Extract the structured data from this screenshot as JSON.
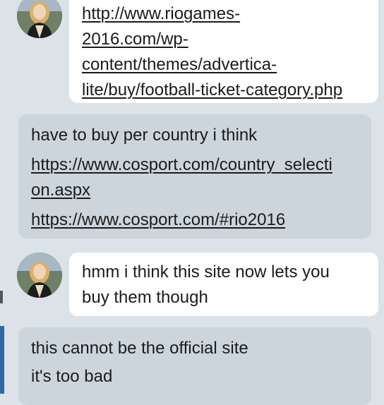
{
  "conversation": {
    "messages": [
      {
        "sender": "other",
        "link_lines": [
          "http://www.riogames-",
          "2016.com/wp-",
          "content/themes/advertica-",
          "lite/buy/football-ticket-category.php"
        ]
      },
      {
        "sender": "me",
        "text": "have to buy per country i think",
        "link1_lines": [
          "https://www.cosport.com/country_selecti",
          "on.aspx"
        ],
        "link2": "https://www.cosport.com/#rio2016"
      },
      {
        "sender": "other",
        "text_lines": [
          "hmm i think this site now lets you",
          "buy them though"
        ]
      },
      {
        "sender": "me",
        "text1": "this cannot be the official site",
        "text2": "it's too bad"
      }
    ]
  },
  "colors": {
    "background": "#dbe2e8",
    "incoming_bubble": "#ffffff",
    "outgoing_bubble": "#ccd5dc",
    "text": "#1b1b1b"
  }
}
